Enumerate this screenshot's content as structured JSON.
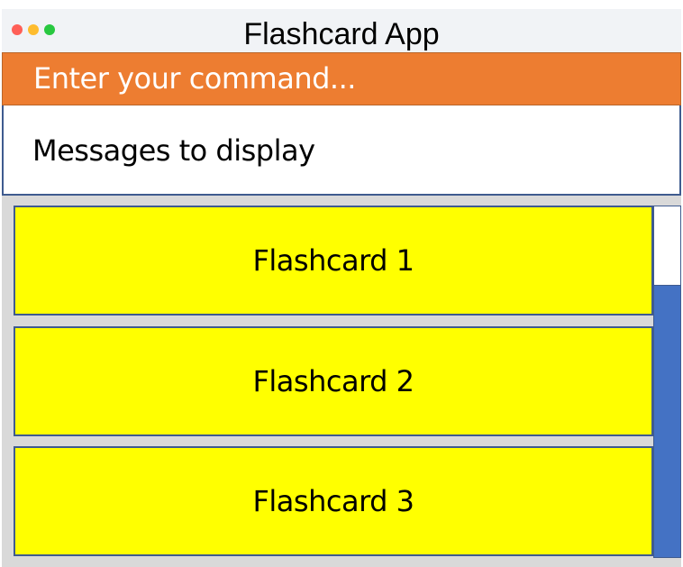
{
  "window": {
    "title": "Flashcard App"
  },
  "command_box": {
    "placeholder": "Enter your command..."
  },
  "result_display": {
    "text": "Messages to display"
  },
  "flashcards": [
    {
      "label": "Flashcard 1"
    },
    {
      "label": "Flashcard 2"
    },
    {
      "label": "Flashcard 3"
    }
  ],
  "colors": {
    "command_bg": "#ed7d31",
    "card_bg": "#ffff00",
    "scrollbar": "#4472c4"
  }
}
